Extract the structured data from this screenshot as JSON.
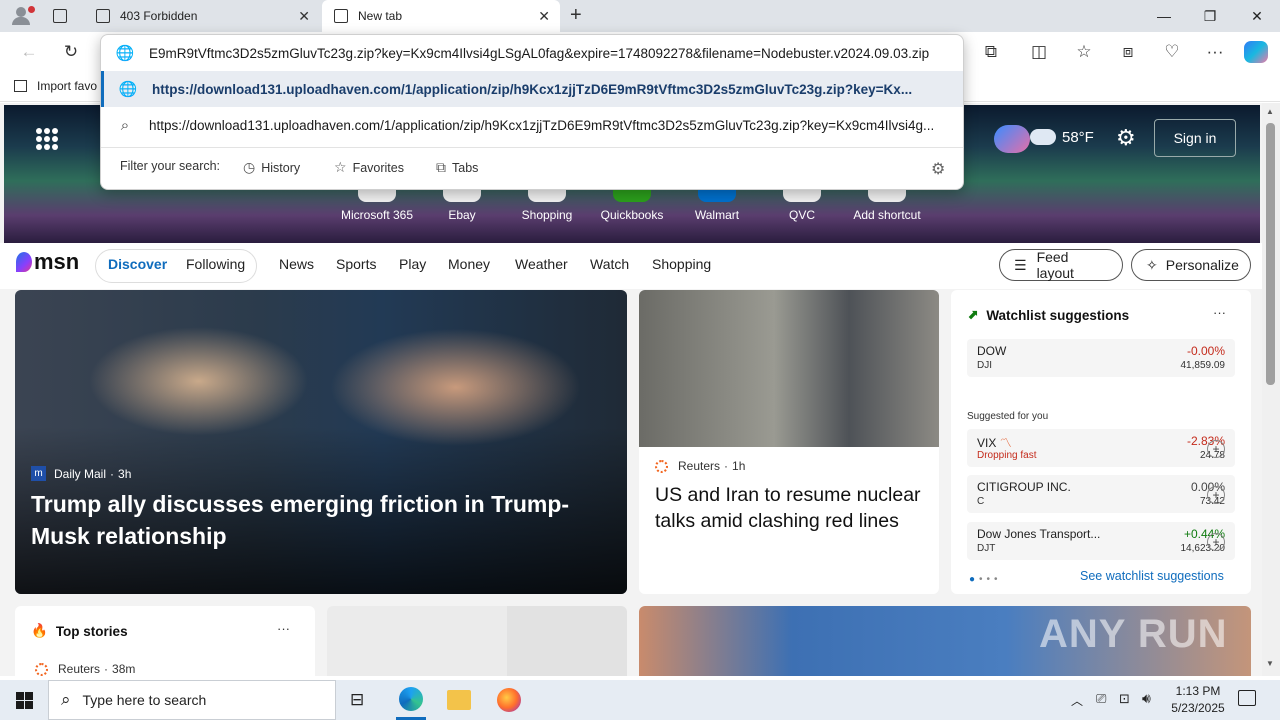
{
  "browser": {
    "tabs": [
      {
        "title": "403 Forbidden",
        "close": "✕"
      },
      {
        "title": "New tab",
        "close": "✕"
      }
    ],
    "new_tab": "+",
    "address_value": "E9mR9tVftmc3D2s5zmGluvTc23g.zip?key=Kx9cm4Ilvsi4gLSgAL0fag&expire=1748092278&filename=Nodebuster.v2024.09.03.zip",
    "suggestions": [
      {
        "icon": "globe-icon",
        "text_bold": "https://download131.uploadhaven.com/1/application/zip/h9Kcx1zjjTzD6E9mR9tVftmc3D2s5zmGluvTc23g.zip?key=Kx..."
      },
      {
        "icon": "search-icon",
        "text": "https://download131.uploadhaven.com/1/application/zip/h9Kcx1zjjTzD6E9mR9tVftmc3D2s5zmGluvTc23g.zip?key=Kx9cm4Ilvsi4g..."
      }
    ],
    "filter_label": "Filter your search:",
    "filters": [
      "History",
      "Favorites",
      "Tabs"
    ],
    "favorites_bar_item": "Import favo"
  },
  "msn": {
    "weather": "58°F",
    "sign_in": "Sign in",
    "shortcuts": [
      "Microsoft 365",
      "Ebay",
      "Shopping",
      "Quickbooks",
      "Walmart",
      "QVC",
      "Add shortcut"
    ],
    "logo": "msn",
    "tabs": [
      "Discover",
      "Following"
    ],
    "nav": [
      "News",
      "Sports",
      "Play",
      "Money",
      "Weather",
      "Watch",
      "Shopping"
    ],
    "feed_layout": "Feed layout",
    "personalize": "Personalize",
    "hero_story": {
      "source": "Daily Mail",
      "age": "3h",
      "headline": "Trump ally discusses emerging friction in Trump-Musk relationship"
    },
    "side_story": {
      "source": "Reuters",
      "age": "1h",
      "headline": "US and Iran to resume nuclear talks amid clashing red lines"
    },
    "watchlist": {
      "title": "Watchlist suggestions",
      "more": "···",
      "main": {
        "name": "DOW",
        "symbol": "DJI",
        "pct": "-0.00%",
        "value": "41,859.09"
      },
      "suggested_label": "Suggested for you",
      "items": [
        {
          "name": "VIX",
          "note": "Dropping fast",
          "pct": "-2.83%",
          "value": "24.78",
          "color": "#c42b1c"
        },
        {
          "name": "CITIGROUP INC.",
          "symbol": "C",
          "pct": "0.00%",
          "value": "73.42",
          "color": "#444444"
        },
        {
          "name": "Dow Jones Transport...",
          "symbol": "DJT",
          "pct": "+0.44%",
          "value": "14,623.20",
          "color": "#0f7b0f"
        }
      ],
      "see_more": "See watchlist suggestions"
    },
    "top_stories": {
      "title": "Top stories",
      "more": "···",
      "first_source": "Reuters",
      "first_age": "38m"
    },
    "watermark": "ANY RUN"
  },
  "taskbar": {
    "search_placeholder": "Type here to search",
    "time": "1:13 PM",
    "date": "5/23/2025"
  }
}
